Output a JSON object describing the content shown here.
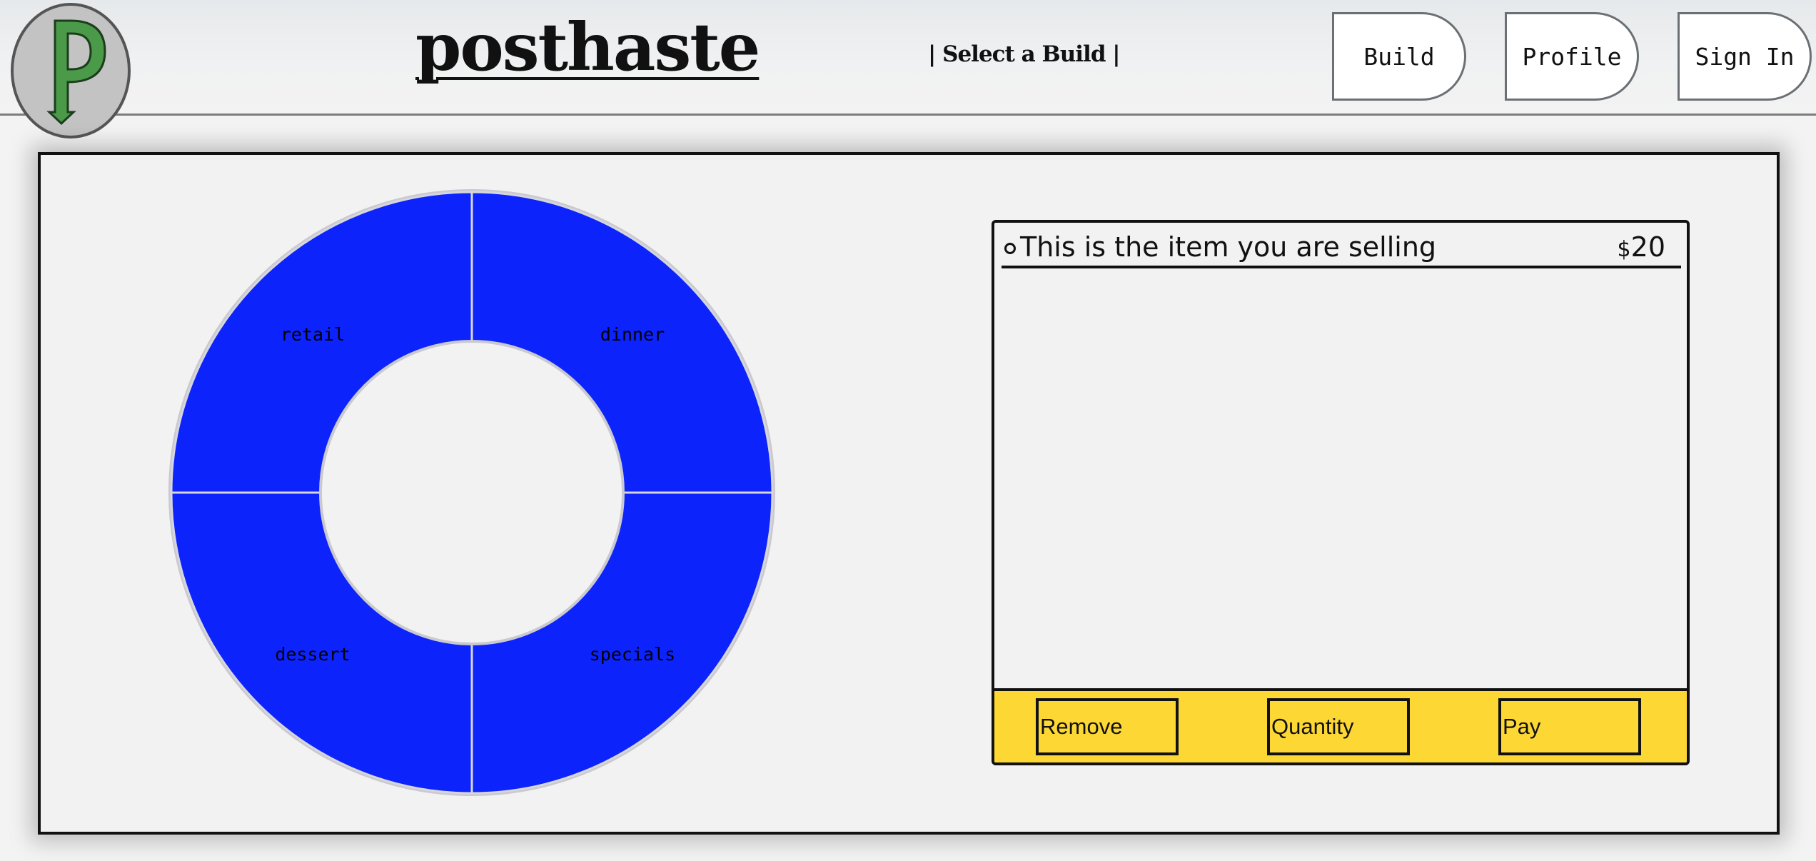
{
  "header": {
    "logo_letter": "p",
    "title": "posthaste",
    "subtitle": "| Select a Build |",
    "nav": {
      "build_label": "Build",
      "profile_label": "Profile",
      "signin_label": "Sign In"
    }
  },
  "menu_ring": {
    "segment_color": "#0c24fb",
    "segments": [
      {
        "label": "retail"
      },
      {
        "label": "dinner"
      },
      {
        "label": "dessert"
      },
      {
        "label": "specials"
      }
    ]
  },
  "cart": {
    "items": [
      {
        "name": "This is the item you are selling",
        "currency": "$",
        "price": "20"
      }
    ],
    "footer_color": "#fdd835",
    "actions": {
      "remove_label": "Remove",
      "quantity_label": "Quantity",
      "pay_label": "Pay"
    }
  }
}
